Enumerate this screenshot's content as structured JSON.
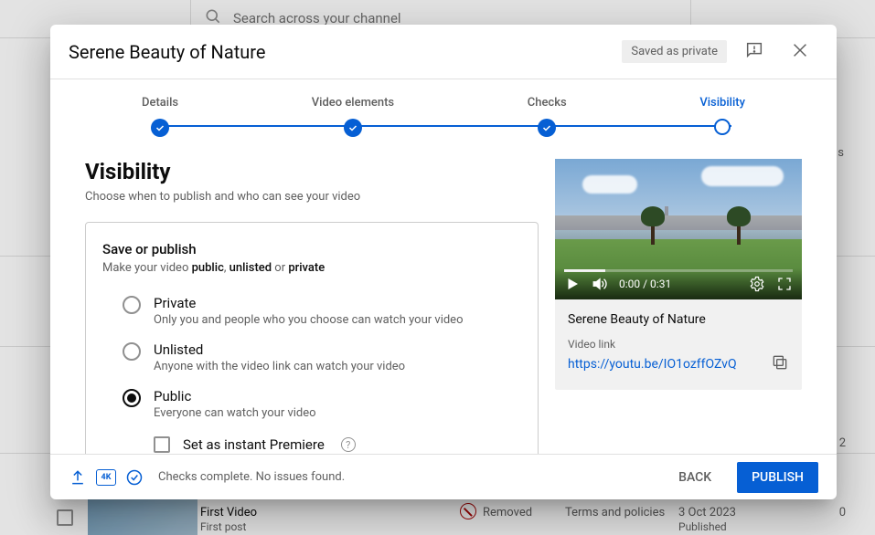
{
  "backdrop": {
    "search_placeholder": "Search across your channel",
    "row": {
      "title": "First Video",
      "subtitle": "First post",
      "status": "Removed",
      "policy": "Terms and policies",
      "date": "3 Oct 2023",
      "date_sub": "Published",
      "edge_num": "2",
      "edge_zero": "0",
      "edge_s": "s"
    }
  },
  "modal": {
    "title": "Serene Beauty of Nature",
    "saved_badge": "Saved as private"
  },
  "stepper": {
    "steps": [
      {
        "label": "Details"
      },
      {
        "label": "Video elements"
      },
      {
        "label": "Checks"
      },
      {
        "label": "Visibility"
      }
    ]
  },
  "visibility": {
    "heading": "Visibility",
    "sub": "Choose when to publish and who can see your video",
    "box_heading": "Save or publish",
    "box_sub_pre": "Make your video ",
    "box_sub_b1": "public",
    "box_sub_mid1": ", ",
    "box_sub_b2": "unlisted",
    "box_sub_mid2": " or ",
    "box_sub_b3": "private",
    "options": [
      {
        "label": "Private",
        "desc": "Only you and people who you choose can watch your video"
      },
      {
        "label": "Unlisted",
        "desc": "Anyone with the video link can watch your video"
      },
      {
        "label": "Public",
        "desc": "Everyone can watch your video"
      }
    ],
    "premiere_label": "Set as instant Premiere"
  },
  "preview": {
    "time": "0:00 / 0:31",
    "title": "Serene Beauty of Nature",
    "link_label": "Video link",
    "link": "https://youtu.be/IO1ozffOZvQ"
  },
  "footer": {
    "hd": "4K",
    "message": "Checks complete. No issues found.",
    "back": "BACK",
    "publish": "PUBLISH"
  }
}
